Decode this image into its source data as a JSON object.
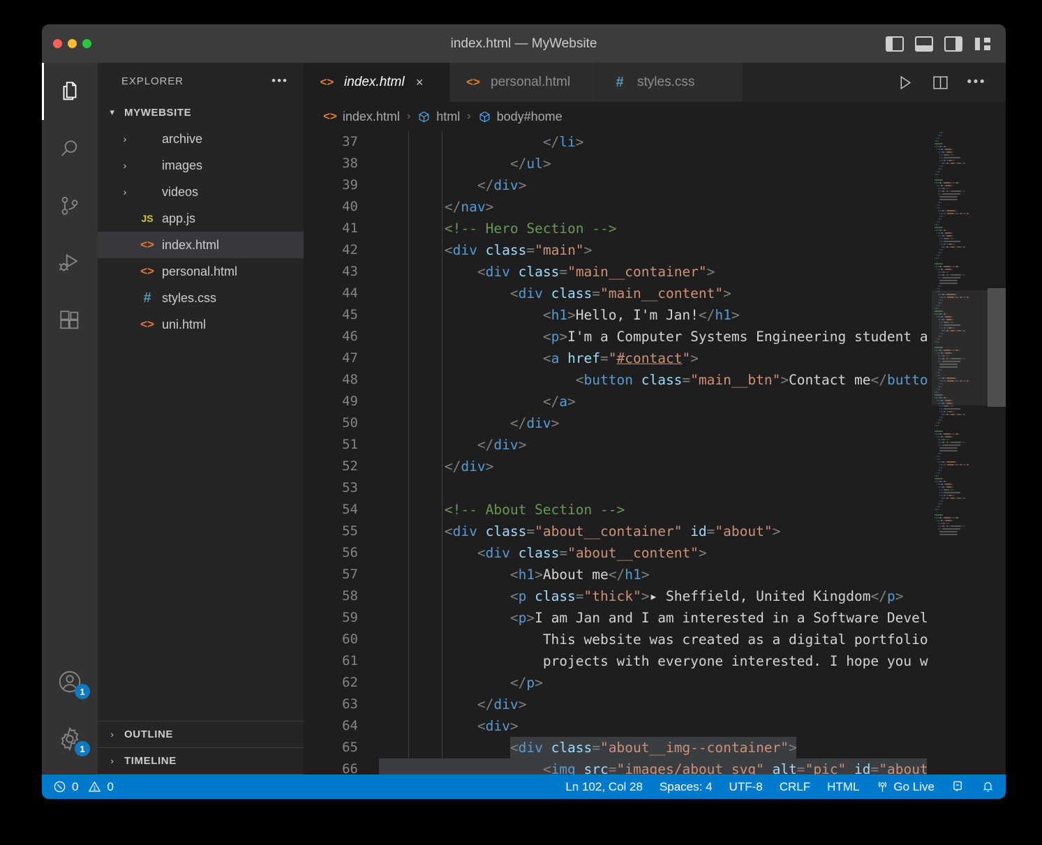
{
  "window": {
    "title": "index.html — MyWebsite",
    "traffic_lights": [
      "close-red",
      "minimize-yellow",
      "maximize-green"
    ],
    "layout_buttons": [
      "toggle-primary-sidebar",
      "toggle-panel",
      "toggle-secondary-sidebar",
      "customize-layout"
    ]
  },
  "activitybar": {
    "items": [
      {
        "name": "explorer",
        "icon": "files-icon",
        "active": true,
        "badge": ""
      },
      {
        "name": "search",
        "icon": "search-icon",
        "active": false,
        "badge": ""
      },
      {
        "name": "source-control",
        "icon": "source-control-icon",
        "active": false,
        "badge": ""
      },
      {
        "name": "run-and-debug",
        "icon": "run-debug-icon",
        "active": false,
        "badge": ""
      },
      {
        "name": "extensions",
        "icon": "extensions-icon",
        "active": false,
        "badge": ""
      }
    ],
    "bottom_items": [
      {
        "name": "accounts",
        "icon": "account-icon",
        "badge": "1"
      },
      {
        "name": "manage-settings",
        "icon": "gear-icon",
        "badge": "1"
      }
    ]
  },
  "sidebar": {
    "header_title": "EXPLORER",
    "header_more": "•••",
    "root_folder": "MYWEBSITE",
    "files": [
      {
        "label": "archive",
        "type": "folder",
        "icon": "chevron-right-icon",
        "selected": false
      },
      {
        "label": "images",
        "type": "folder",
        "icon": "chevron-right-icon",
        "selected": false
      },
      {
        "label": "videos",
        "type": "folder",
        "icon": "chevron-right-icon",
        "selected": false
      },
      {
        "label": "app.js",
        "type": "js",
        "icon": "js-icon",
        "selected": false
      },
      {
        "label": "index.html",
        "type": "html",
        "icon": "html-icon",
        "selected": true
      },
      {
        "label": "personal.html",
        "type": "html",
        "icon": "html-icon",
        "selected": false
      },
      {
        "label": "styles.css",
        "type": "css",
        "icon": "css-icon",
        "selected": false
      },
      {
        "label": "uni.html",
        "type": "html",
        "icon": "html-icon",
        "selected": false
      }
    ],
    "bottom_sections": [
      {
        "label": "OUTLINE"
      },
      {
        "label": "TIMELINE"
      }
    ]
  },
  "editor": {
    "tabs": [
      {
        "label": "index.html",
        "icon": "html-icon",
        "active": true,
        "close": "×"
      },
      {
        "label": "personal.html",
        "icon": "html-icon",
        "active": false,
        "close": ""
      },
      {
        "label": "styles.css",
        "icon": "css-icon",
        "active": false,
        "close": ""
      }
    ],
    "tab_actions": [
      "run-icon",
      "split-editor-icon",
      "more-actions-icon"
    ],
    "breadcrumb": [
      {
        "label": "index.html",
        "icon": "html-icon"
      },
      {
        "label": "html",
        "icon": "symbol-cube-icon"
      },
      {
        "label": "body#home",
        "icon": "symbol-cube-icon"
      }
    ],
    "first_line_number": 37,
    "lines": [
      {
        "n": 37,
        "indent": 5,
        "tokens": [
          {
            "t": "punc",
            "v": "</"
          },
          {
            "t": "tag",
            "v": "li"
          },
          {
            "t": "punc",
            "v": ">"
          }
        ]
      },
      {
        "n": 38,
        "indent": 4,
        "tokens": [
          {
            "t": "punc",
            "v": "</"
          },
          {
            "t": "tag",
            "v": "ul"
          },
          {
            "t": "punc",
            "v": ">"
          }
        ]
      },
      {
        "n": 39,
        "indent": 3,
        "tokens": [
          {
            "t": "punc",
            "v": "</"
          },
          {
            "t": "tag",
            "v": "div"
          },
          {
            "t": "punc",
            "v": ">"
          }
        ]
      },
      {
        "n": 40,
        "indent": 2,
        "tokens": [
          {
            "t": "punc",
            "v": "</"
          },
          {
            "t": "tag",
            "v": "nav"
          },
          {
            "t": "punc",
            "v": ">"
          }
        ]
      },
      {
        "n": 41,
        "indent": 2,
        "tokens": [
          {
            "t": "cmt",
            "v": "<!-- Hero Section -->"
          }
        ]
      },
      {
        "n": 42,
        "indent": 2,
        "tokens": [
          {
            "t": "punc",
            "v": "<"
          },
          {
            "t": "tag",
            "v": "div"
          },
          {
            "t": "txt",
            "v": " "
          },
          {
            "t": "attr",
            "v": "class"
          },
          {
            "t": "punc",
            "v": "="
          },
          {
            "t": "str",
            "v": "\"main\""
          },
          {
            "t": "punc",
            "v": ">"
          }
        ]
      },
      {
        "n": 43,
        "indent": 3,
        "tokens": [
          {
            "t": "punc",
            "v": "<"
          },
          {
            "t": "tag",
            "v": "div"
          },
          {
            "t": "txt",
            "v": " "
          },
          {
            "t": "attr",
            "v": "class"
          },
          {
            "t": "punc",
            "v": "="
          },
          {
            "t": "str",
            "v": "\"main__container\""
          },
          {
            "t": "punc",
            "v": ">"
          }
        ]
      },
      {
        "n": 44,
        "indent": 4,
        "tokens": [
          {
            "t": "punc",
            "v": "<"
          },
          {
            "t": "tag",
            "v": "div"
          },
          {
            "t": "txt",
            "v": " "
          },
          {
            "t": "attr",
            "v": "class"
          },
          {
            "t": "punc",
            "v": "="
          },
          {
            "t": "str",
            "v": "\"main__content\""
          },
          {
            "t": "punc",
            "v": ">"
          }
        ]
      },
      {
        "n": 45,
        "indent": 5,
        "tokens": [
          {
            "t": "punc",
            "v": "<"
          },
          {
            "t": "tag",
            "v": "h1"
          },
          {
            "t": "punc",
            "v": ">"
          },
          {
            "t": "txt",
            "v": "Hello, I'm Jan!"
          },
          {
            "t": "punc",
            "v": "</"
          },
          {
            "t": "tag",
            "v": "h1"
          },
          {
            "t": "punc",
            "v": ">"
          }
        ]
      },
      {
        "n": 46,
        "indent": 5,
        "tokens": [
          {
            "t": "punc",
            "v": "<"
          },
          {
            "t": "tag",
            "v": "p"
          },
          {
            "t": "punc",
            "v": ">"
          },
          {
            "t": "txt",
            "v": "I'm a Computer Systems Engineering student a"
          }
        ]
      },
      {
        "n": 47,
        "indent": 5,
        "tokens": [
          {
            "t": "punc",
            "v": "<"
          },
          {
            "t": "tag",
            "v": "a"
          },
          {
            "t": "txt",
            "v": " "
          },
          {
            "t": "attr",
            "v": "href"
          },
          {
            "t": "punc",
            "v": "="
          },
          {
            "t": "str",
            "v": "\""
          },
          {
            "t": "link",
            "v": "#contact"
          },
          {
            "t": "str",
            "v": "\""
          },
          {
            "t": "punc",
            "v": ">"
          }
        ]
      },
      {
        "n": 48,
        "indent": 6,
        "tokens": [
          {
            "t": "punc",
            "v": "<"
          },
          {
            "t": "tag",
            "v": "button"
          },
          {
            "t": "txt",
            "v": " "
          },
          {
            "t": "attr",
            "v": "class"
          },
          {
            "t": "punc",
            "v": "="
          },
          {
            "t": "str",
            "v": "\"main__btn\""
          },
          {
            "t": "punc",
            "v": ">"
          },
          {
            "t": "txt",
            "v": "Contact me"
          },
          {
            "t": "punc",
            "v": "</"
          },
          {
            "t": "tag",
            "v": "butto"
          }
        ]
      },
      {
        "n": 49,
        "indent": 5,
        "tokens": [
          {
            "t": "punc",
            "v": "</"
          },
          {
            "t": "tag",
            "v": "a"
          },
          {
            "t": "punc",
            "v": ">"
          }
        ]
      },
      {
        "n": 50,
        "indent": 4,
        "tokens": [
          {
            "t": "punc",
            "v": "</"
          },
          {
            "t": "tag",
            "v": "div"
          },
          {
            "t": "punc",
            "v": ">"
          }
        ]
      },
      {
        "n": 51,
        "indent": 3,
        "tokens": [
          {
            "t": "punc",
            "v": "</"
          },
          {
            "t": "tag",
            "v": "div"
          },
          {
            "t": "punc",
            "v": ">"
          }
        ]
      },
      {
        "n": 52,
        "indent": 2,
        "tokens": [
          {
            "t": "punc",
            "v": "</"
          },
          {
            "t": "tag",
            "v": "div"
          },
          {
            "t": "punc",
            "v": ">"
          }
        ]
      },
      {
        "n": 53,
        "indent": 0,
        "tokens": []
      },
      {
        "n": 54,
        "indent": 2,
        "tokens": [
          {
            "t": "cmt",
            "v": "<!-- About Section -->"
          }
        ]
      },
      {
        "n": 55,
        "indent": 2,
        "tokens": [
          {
            "t": "punc",
            "v": "<"
          },
          {
            "t": "tag",
            "v": "div"
          },
          {
            "t": "txt",
            "v": " "
          },
          {
            "t": "attr",
            "v": "class"
          },
          {
            "t": "punc",
            "v": "="
          },
          {
            "t": "str",
            "v": "\"about__container\""
          },
          {
            "t": "txt",
            "v": " "
          },
          {
            "t": "attr",
            "v": "id"
          },
          {
            "t": "punc",
            "v": "="
          },
          {
            "t": "str",
            "v": "\"about\""
          },
          {
            "t": "punc",
            "v": ">"
          }
        ]
      },
      {
        "n": 56,
        "indent": 3,
        "tokens": [
          {
            "t": "punc",
            "v": "<"
          },
          {
            "t": "tag",
            "v": "div"
          },
          {
            "t": "txt",
            "v": " "
          },
          {
            "t": "attr",
            "v": "class"
          },
          {
            "t": "punc",
            "v": "="
          },
          {
            "t": "str",
            "v": "\"about__content\""
          },
          {
            "t": "punc",
            "v": ">"
          }
        ]
      },
      {
        "n": 57,
        "indent": 4,
        "tokens": [
          {
            "t": "punc",
            "v": "<"
          },
          {
            "t": "tag",
            "v": "h1"
          },
          {
            "t": "punc",
            "v": ">"
          },
          {
            "t": "txt",
            "v": "About me"
          },
          {
            "t": "punc",
            "v": "</"
          },
          {
            "t": "tag",
            "v": "h1"
          },
          {
            "t": "punc",
            "v": ">"
          }
        ]
      },
      {
        "n": 58,
        "indent": 4,
        "tokens": [
          {
            "t": "punc",
            "v": "<"
          },
          {
            "t": "tag",
            "v": "p"
          },
          {
            "t": "txt",
            "v": " "
          },
          {
            "t": "attr",
            "v": "class"
          },
          {
            "t": "punc",
            "v": "="
          },
          {
            "t": "str",
            "v": "\"thick\""
          },
          {
            "t": "punc",
            "v": ">"
          },
          {
            "t": "txt",
            "v": "▸ Sheffield, United Kingdom"
          },
          {
            "t": "punc",
            "v": "</"
          },
          {
            "t": "tag",
            "v": "p"
          },
          {
            "t": "punc",
            "v": ">"
          }
        ]
      },
      {
        "n": 59,
        "indent": 4,
        "tokens": [
          {
            "t": "punc",
            "v": "<"
          },
          {
            "t": "tag",
            "v": "p"
          },
          {
            "t": "punc",
            "v": ">"
          },
          {
            "t": "txt",
            "v": "I am Jan and I am interested in a Software Devel"
          }
        ]
      },
      {
        "n": 60,
        "indent": 5,
        "tokens": [
          {
            "t": "txt",
            "v": "This website was created as a digital portfolio"
          }
        ]
      },
      {
        "n": 61,
        "indent": 5,
        "tokens": [
          {
            "t": "txt",
            "v": "projects with everyone interested. I hope you w"
          }
        ]
      },
      {
        "n": 62,
        "indent": 4,
        "tokens": [
          {
            "t": "punc",
            "v": "</"
          },
          {
            "t": "tag",
            "v": "p"
          },
          {
            "t": "punc",
            "v": ">"
          }
        ]
      },
      {
        "n": 63,
        "indent": 3,
        "tokens": [
          {
            "t": "punc",
            "v": "</"
          },
          {
            "t": "tag",
            "v": "div"
          },
          {
            "t": "punc",
            "v": ">"
          }
        ]
      },
      {
        "n": 64,
        "indent": 3,
        "tokens": [
          {
            "t": "punc",
            "v": "<"
          },
          {
            "t": "tag",
            "v": "div"
          },
          {
            "t": "punc",
            "v": ">"
          }
        ]
      },
      {
        "n": 65,
        "indent": 4,
        "tokens": [
          {
            "t": "punc",
            "v": "<"
          },
          {
            "t": "tag",
            "v": "div"
          },
          {
            "t": "txt",
            "v": " "
          },
          {
            "t": "attr",
            "v": "class"
          },
          {
            "t": "punc",
            "v": "="
          },
          {
            "t": "str",
            "v": "\"about__img--container\""
          },
          {
            "t": "punc",
            "v": ">"
          }
        ],
        "selected_from": 4
      },
      {
        "n": 66,
        "indent": 5,
        "tokens": [
          {
            "t": "punc",
            "v": "<"
          },
          {
            "t": "tag",
            "v": "img"
          },
          {
            "t": "txt",
            "v": " "
          },
          {
            "t": "attr",
            "v": "src"
          },
          {
            "t": "punc",
            "v": "="
          },
          {
            "t": "str",
            "v": "\"images/about_svg\""
          },
          {
            "t": "txt",
            "v": " "
          },
          {
            "t": "attr",
            "v": "alt"
          },
          {
            "t": "punc",
            "v": "="
          },
          {
            "t": "str",
            "v": "\"pic\""
          },
          {
            "t": "txt",
            "v": " "
          },
          {
            "t": "attr",
            "v": "id"
          },
          {
            "t": "punc",
            "v": "="
          },
          {
            "t": "str",
            "v": "\"about"
          }
        ],
        "selected_from": 0
      }
    ]
  },
  "statusbar": {
    "problems": {
      "errors_icon": "error-circle-icon",
      "errors": "0",
      "warnings_icon": "warning-triangle-icon",
      "warnings": "0"
    },
    "right_items": [
      {
        "name": "cursor-position",
        "label": "Ln 102, Col 28"
      },
      {
        "name": "indentation",
        "label": "Spaces: 4"
      },
      {
        "name": "encoding",
        "label": "UTF-8"
      },
      {
        "name": "eol",
        "label": "CRLF"
      },
      {
        "name": "language-mode",
        "label": "HTML"
      },
      {
        "name": "go-live",
        "label": "Go Live",
        "icon": "broadcast-icon"
      },
      {
        "name": "remote-tunnel",
        "label": "",
        "icon": "remote-icon"
      },
      {
        "name": "notifications",
        "label": "",
        "icon": "bell-icon"
      }
    ]
  },
  "colors": {
    "accent": "#007acc",
    "editor_bg": "#1e1e1e",
    "sidebar_bg": "#252526",
    "activitybar_bg": "#333333",
    "titlebar_bg": "#3c3c3c",
    "badge_bg": "#0e7ac4",
    "tag": "#569cd6",
    "attr": "#9cdcfe",
    "string": "#ce9178",
    "comment": "#6a9955",
    "text": "#d4d4d4",
    "selection": "#3a3d41"
  }
}
